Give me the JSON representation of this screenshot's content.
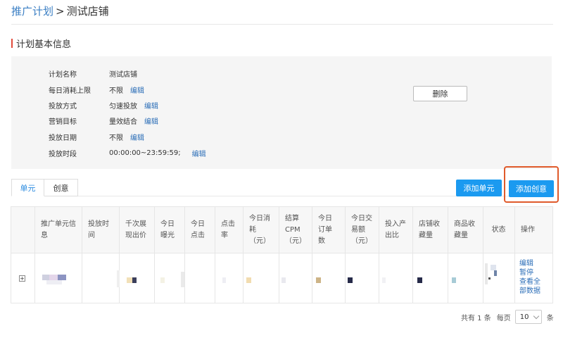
{
  "breadcrumb": {
    "parent": "推广计划",
    "separator": ">",
    "current": "测试店铺"
  },
  "section_title": "计划基本信息",
  "plan_info": {
    "rows": [
      {
        "label": "计划名称",
        "value": "测试店铺",
        "edit": ""
      },
      {
        "label": "每日消耗上限",
        "value": "不限",
        "edit": "编辑"
      },
      {
        "label": "投放方式",
        "value": "匀速投放",
        "edit": "编辑"
      },
      {
        "label": "营销目标",
        "value": "量效结合",
        "edit": "编辑"
      },
      {
        "label": "投放日期",
        "value": "不限",
        "edit": "编辑"
      },
      {
        "label": "投放时段",
        "value": "00:00:00~23:59:59;",
        "edit": "编辑"
      }
    ],
    "delete_label": "删除"
  },
  "tabs": [
    {
      "label": "单元",
      "active": true
    },
    {
      "label": "创意",
      "active": false
    }
  ],
  "actions": {
    "add_unit": "添加单元",
    "add_creative": "添加创意"
  },
  "table": {
    "headers": [
      "推广单元信\n息",
      "投放时\n间",
      "千次展\n现出价",
      "今日\n曝光",
      "今日\n点击",
      "点击\n率",
      "今日消\n耗\n（元）",
      "结算\nCPM\n（元）",
      "今日\n订单\n数",
      "今日交\n易额\n（元）",
      "投入产\n出比",
      "店铺收\n藏量",
      "商品收\n藏量",
      "状态",
      "操作"
    ],
    "expand_symbol": "+",
    "row_ops": [
      "编辑",
      "暂停",
      "查看全",
      "部数据"
    ]
  },
  "pagination": {
    "total_text": "共有 1 条",
    "per_page_label": "每页",
    "page_size": "10",
    "unit": "条"
  },
  "colors": {
    "accent_blue": "#1b9af0",
    "link_blue": "#2d6fb8",
    "highlight": "#e05a2b",
    "title_bar": "#e14b3b"
  }
}
